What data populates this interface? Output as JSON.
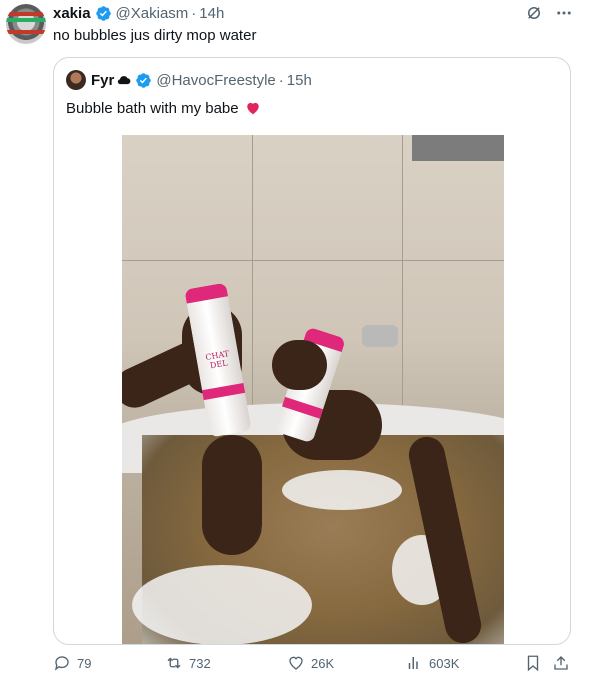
{
  "tweet": {
    "author": {
      "display_name": "xakia",
      "handle": "@Xakiasm",
      "separator": "·",
      "time": "14h",
      "verified": true
    },
    "text": "no bubbles jus dirty mop water",
    "top_icons": [
      "grok-slash-icon",
      "more-icon"
    ]
  },
  "quote": {
    "author": {
      "display_name": "Fyr",
      "name_emoji": "cloud-icon",
      "handle": "@HavocFreestyle",
      "separator": "·",
      "time": "15h",
      "verified": true
    },
    "text": "Bubble bath with my babe",
    "text_emoji": "red-heart-icon",
    "media": {
      "type": "photo",
      "can_label": "CHAT DEL"
    }
  },
  "actions": {
    "replies": "79",
    "reposts": "732",
    "likes": "26K",
    "views": "603K",
    "bookmark": "bookmark-icon",
    "share": "share-icon"
  },
  "colors": {
    "text": "#0f1419",
    "secondary": "#536471",
    "verified_blue": "#1d9bf0",
    "border": "#cfd9de",
    "can_pink": "#e0287a",
    "heart_red": "#e0245e"
  }
}
